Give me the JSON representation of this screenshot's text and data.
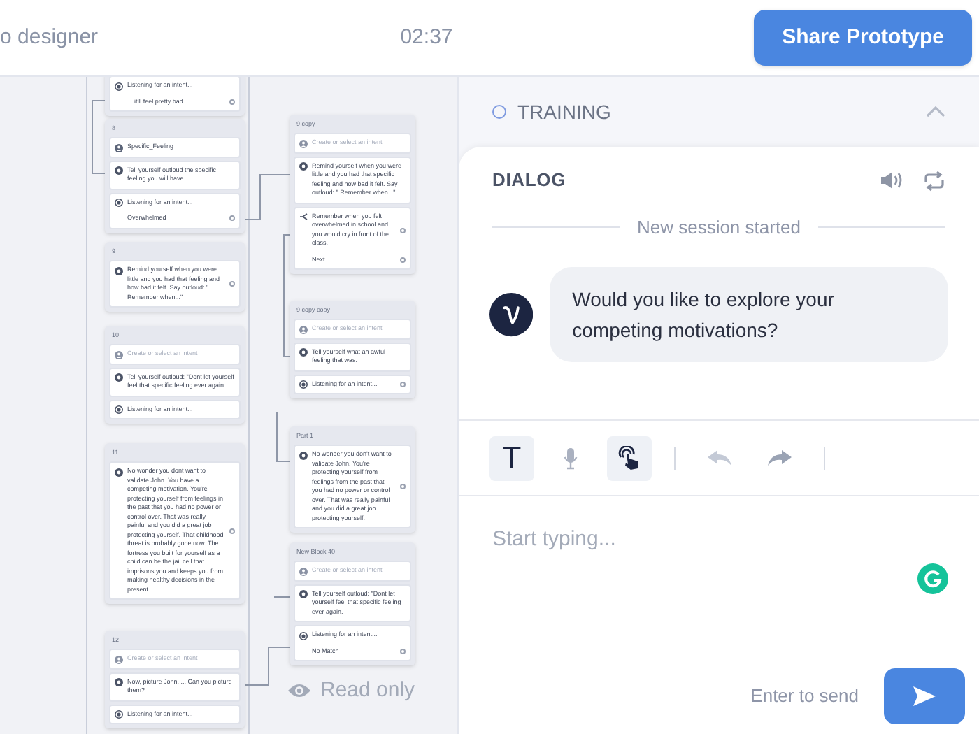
{
  "header": {
    "title": "o designer",
    "timer": "02:37",
    "share_button": "Share Prototype"
  },
  "canvas": {
    "blocks": [
      {
        "steps": [
          {
            "kind": "listen",
            "text": "Listening for an intent...",
            "port": false,
            "choices": [
              {
                "label": "... it'll feel pretty bad",
                "port": true
              }
            ]
          }
        ]
      },
      {
        "title": "8",
        "steps": [
          {
            "kind": "intent",
            "text": "Specific_Feeling",
            "port": false
          },
          {
            "kind": "speak",
            "text": "Tell yourself outloud the specific feeling you will have...",
            "port": false
          },
          {
            "kind": "listen",
            "text": "Listening for an intent...",
            "port": false,
            "choices": [
              {
                "label": "Overwhelmed",
                "port": true
              }
            ]
          }
        ]
      },
      {
        "title": "9",
        "steps": [
          {
            "kind": "speak",
            "text": "Remind yourself when you were little and you had that feeling and how bad it felt. Say outloud: \" Remember when...\"",
            "port": true
          }
        ]
      },
      {
        "title": "10",
        "steps": [
          {
            "kind": "intent_prompt",
            "text": "Create or select an intent",
            "port": false
          },
          {
            "kind": "speak",
            "text": "Tell yourself outloud: \"Dont let yourself feel that specific feeling ever again.",
            "port": false
          },
          {
            "kind": "listen",
            "text": "Listening for an intent...",
            "port": false
          }
        ]
      },
      {
        "title": "11",
        "steps": [
          {
            "kind": "speak",
            "text": "No wonder you dont want to validate John. You have a competing motivation. You're protecting yourself from feelings in the past that you had no power or control over. That was really painful and you did a great job protecting yourself. That childhood threat is probably gone now. The fortress you built for yourself as a child can be the jail cell that imprisons you and keeps you from making healthy decisions in the present.",
            "port": true
          }
        ]
      },
      {
        "title": "12",
        "steps": [
          {
            "kind": "intent_prompt",
            "text": "Create or select an intent",
            "port": false
          },
          {
            "kind": "speak",
            "text": "Now, picture John, ... Can you picture them?",
            "port": false
          },
          {
            "kind": "listen",
            "text": "Listening for an intent...",
            "port": false
          }
        ]
      },
      {
        "title": "9 copy",
        "steps": [
          {
            "kind": "intent_prompt",
            "text": "Create or select an intent",
            "port": false
          },
          {
            "kind": "speak",
            "text": "Remind yourself when you were little and you had that specific feeling and how bad it felt. Say outloud: \" Remember when...\"",
            "port": false
          },
          {
            "kind": "random",
            "text": "Remember when you felt overwhelmed in school and you would cry in front of the class.",
            "port": true,
            "choices": [
              {
                "label": "Next",
                "port": true
              }
            ]
          }
        ]
      },
      {
        "title": "9 copy copy",
        "steps": [
          {
            "kind": "intent_prompt",
            "text": "Create or select an intent",
            "port": false
          },
          {
            "kind": "speak",
            "text": "Tell yourself what an awful feeling that was.",
            "port": false
          },
          {
            "kind": "listen",
            "text": "Listening for an intent...",
            "port": true
          }
        ]
      },
      {
        "title": "Part 1",
        "steps": [
          {
            "kind": "speak",
            "text": "No wonder you don't want to validate John. You're protecting yourself from feelings from the past that you had no power or control over. That was really painful and you did a great job protecting yourself.",
            "port": true
          }
        ]
      },
      {
        "title": "New Block 40",
        "steps": [
          {
            "kind": "intent_prompt",
            "text": "Create or select an intent",
            "port": false
          },
          {
            "kind": "speak",
            "text": "Tell yourself outloud: \"Dont let yourself feel that specific feeling ever again.",
            "port": false
          },
          {
            "kind": "listen",
            "text": "Listening for an intent...",
            "port": false,
            "choices": [
              {
                "label": "No Match",
                "port": true
              }
            ]
          }
        ]
      }
    ],
    "read_only": "Read only"
  },
  "panel": {
    "training": {
      "label": "TRAINING",
      "expanded": true
    },
    "dialog": {
      "title": "DIALOG",
      "divider": "New session started",
      "message": "Would you like to explore your competing motivations?"
    },
    "tools": [
      {
        "kind": "text",
        "label": "T",
        "selected": true
      },
      {
        "kind": "mic",
        "selected": false
      },
      {
        "kind": "tap",
        "selected": true
      },
      {
        "kind": "separator"
      },
      {
        "kind": "undo",
        "disabled": true
      },
      {
        "kind": "redo",
        "disabled": false
      },
      {
        "kind": "separator"
      }
    ],
    "input": {
      "placeholder": "Start typing..."
    },
    "send_hint": "Enter to send"
  }
}
